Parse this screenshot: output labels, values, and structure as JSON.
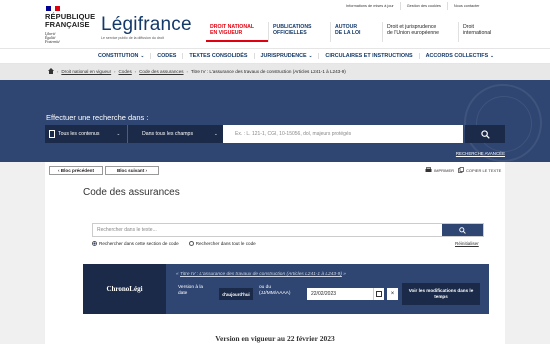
{
  "header": {
    "republic_line1": "RÉPUBLIQUE",
    "republic_line2": "FRANÇAISE",
    "motto_line1": "Liberté",
    "motto_line2": "Égalité",
    "motto_line3": "Fraternité",
    "brand": "Légifrance",
    "tagline": "Le service public de la diffusion du droit",
    "top_links": [
      "Informations de mises à jour",
      "Gestion des cookies",
      "Nous contacter"
    ],
    "main_nav": [
      {
        "line1": "DROIT NATIONAL",
        "line2": "EN VIGUEUR"
      },
      {
        "line1": "PUBLICATIONS",
        "line2": "OFFICIELLES"
      },
      {
        "line1": "AUTOUR",
        "line2": "DE LA LOI"
      },
      {
        "line1": "Droit et jurisprudence",
        "line2": "de l'Union européenne"
      },
      {
        "line1": "Droit",
        "line2": "international"
      }
    ]
  },
  "subnav": [
    "CONSTITUTION",
    "CODES",
    "TEXTES CONSOLIDÉS",
    "JURISPRUDENCE",
    "CIRCULAIRES ET INSTRUCTIONS",
    "ACCORDS COLLECTIFS"
  ],
  "breadcrumb": [
    "Droit national en vigueur",
    "Codes",
    "Code des assurances",
    "Titre IV : L'assurance des travaux de construction (Articles L241-1 à L243-9)"
  ],
  "search": {
    "title": "Effectuer une recherche dans :",
    "content_select": "Tous les contenus",
    "field_select": "Dans tous les champs",
    "placeholder": "Ex. : L. 121-1, CGI, 10-15056, dol, majeurs protégés",
    "advanced": "RECHERCHE AVANCÉE"
  },
  "main": {
    "prev_label": "‹ Bloc précédent",
    "next_label": "Bloc suivant ›",
    "print_label": "IMPRIMER",
    "copy_label": "COPIER LE TEXTE",
    "title": "Code des assurances",
    "code_search_placeholder": "Rechercher dans le texte...",
    "radio_section": "Rechercher dans cette section de code",
    "radio_all": "Rechercher dans tout le code",
    "reset": "Réinitialiser",
    "chrono": {
      "tab": "ChronoLégi",
      "context_prefix": "« ",
      "context_link": "Titre IV : L'assurance des travaux de construction (Articles L241-1 à L243-9)",
      "context_suffix": " »",
      "version_label": "Version à la date",
      "today": "d'aujourd'hui",
      "or_label": "ou du",
      "format": "(JJ/MM/AAAA)",
      "date_value": "22/02/2023",
      "clear": "×",
      "apply": "Voir les modifications dans le temps"
    },
    "version_heading": "Version en vigueur au 22 février 2023"
  },
  "colors": {
    "navy": "#2f4672",
    "dark_navy": "#1b2a48",
    "brand_blue": "#13396a",
    "red": "#e1000f"
  }
}
